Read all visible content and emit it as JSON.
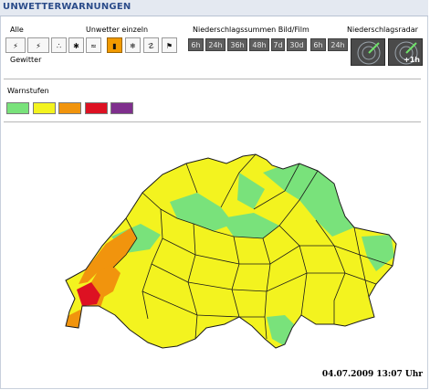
{
  "header": {
    "title": "UNWETTERWARNUNGEN"
  },
  "toolbar": {
    "alle_label": "Alle",
    "gewitter_label": "Gewitter",
    "einzeln_label": "Unwetter einzeln",
    "summen_label": "Niederschlagssummen Bild/Film",
    "radar_label": "Niederschlagsradar",
    "hours_bild": [
      "6h",
      "24h",
      "36h",
      "48h",
      "7d",
      "30d"
    ],
    "hours_film": [
      "6h",
      "24h"
    ],
    "radar_plus": "+1h"
  },
  "legend": {
    "title": "Warnstufen",
    "levels": [
      {
        "color": "#79e27b"
      },
      {
        "color": "#f3f31f"
      },
      {
        "color": "#f1940d"
      },
      {
        "color": "#dd1122"
      },
      {
        "color": "#7f2f8d"
      }
    ]
  },
  "map": {
    "country": "Switzerland"
  },
  "timestamp": "04.07.2009 13:07 Uhr"
}
